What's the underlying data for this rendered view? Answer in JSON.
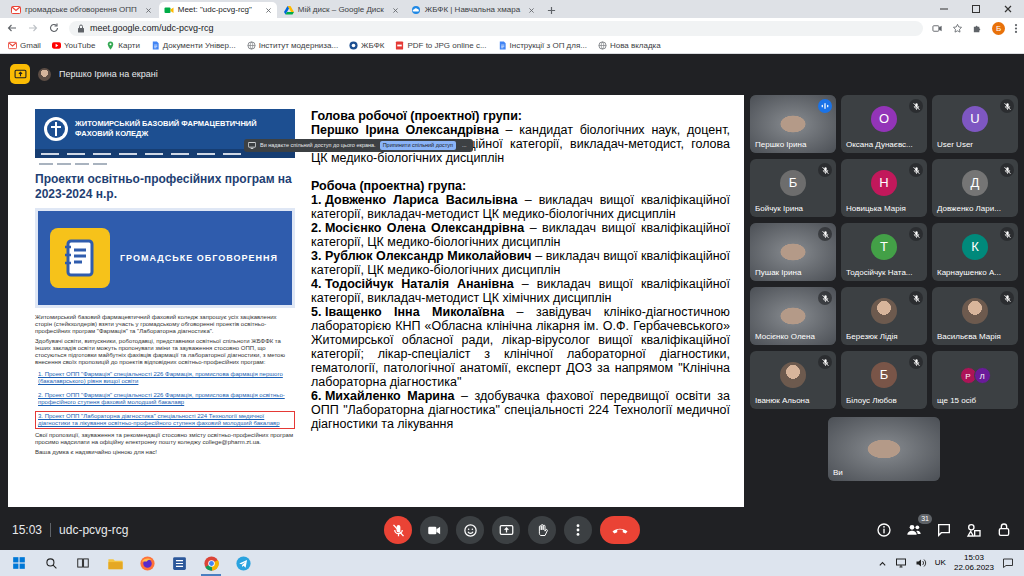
{
  "browser": {
    "tabs": [
      {
        "label": "громадське обговорення ОПП",
        "selected": false,
        "kind": "gmail"
      },
      {
        "label": "Meet: \"udc-pcvg-rcg\"",
        "selected": true,
        "kind": "meet"
      },
      {
        "label": "Мій диск – Google Диск",
        "selected": false,
        "kind": "drive"
      },
      {
        "label": "ЖБФК | Навчальна хмара",
        "selected": false,
        "kind": "cloud"
      }
    ],
    "address": "meet.google.com/udc-pcvg-rcg",
    "profile": "Б",
    "bookmarks": [
      {
        "label": "Gmail",
        "kind": "gmail"
      },
      {
        "label": "YouTube",
        "kind": "youtube"
      },
      {
        "label": "Карти",
        "kind": "maps"
      },
      {
        "label": "Документи Універ...",
        "kind": "docs"
      },
      {
        "label": "Інститут модерниза...",
        "kind": "globe"
      },
      {
        "label": "ЖБФК",
        "kind": "college"
      },
      {
        "label": "PDF to JPG online c...",
        "kind": "pdf"
      },
      {
        "label": "Інструкції з ОП для...",
        "kind": "docs"
      },
      {
        "label": "Нова вкладка",
        "kind": "globe"
      }
    ]
  },
  "meet": {
    "presenting": "Першко Ірина на екрані",
    "share_banner": {
      "text": "Ви надаєте спільний доступ до цього екрана.",
      "stop": "Припинити спільний доступ",
      "more": "..."
    },
    "slide": {
      "site": {
        "logo": [
          "ЖИТОМИРСЬКИЙ БАЗОВИЙ ФАРМАЦЕВТИЧНИЙ",
          "ФАХОВИЙ КОЛЕДЖ"
        ],
        "title": "Проекти освітньо-професійних програм на 2023-2024 н.р.",
        "banner": "ГРОМАДСЬКЕ ОБГОВОРЕННЯ",
        "intro": [
          "Житомирський базовий фармацевтичний фаховий коледж запрошує усіх зацікавлених сторін (стейкхолдерів) взяти участь у громадському обговоренні проектів освітньо-професійних програм \"Фармація\" та \"Лабораторна діагностика\".",
          "Здобувачі освіти, випускники, роботодавці, представники освітньої спільноти ЖБФФК та інших закладів освіти можуть пропонувати зміни та зауваження стосовно ОПП, що стосуються підготовки майбутніх фахівців фармації та лабораторної діагностики, з метою внесення своїх пропозицій до проектів відповідних освітньо-професійних програм:"
        ],
        "links": [
          {
            "text": "1. Проект ОПП \"Фармація\" спеціальності 226 Фармація, промислова фармація першого (бакалаврського) рівня вищої освіти",
            "selected": false
          },
          {
            "text": "2. Проект ОПП \"Фармація\" спеціальності 226 Фармація, промислова фармація освітньо-професійного ступеня фаховий молодший бакалавр",
            "selected": false
          },
          {
            "text": "3. Проект ОПП \"Лабораторна діагностика\" спеціальності 224 Технології медичної діагностики та лікування освітньо-професійного ступеня фаховий молодший бакалавр",
            "selected": true
          }
        ],
        "outro": [
          "Свої пропозиції, зауваження та рекомендації стосовно змісту освітньо-професійних програм просимо надсилати на офіційну електронну пошту коледжу college@pharm.zt.ua.",
          "Ваша думка є надзвичайно цінною для нас!"
        ]
      },
      "head_title": "Голова робочої (проектної) групи:",
      "head_name": "Першко Ірина Олександрівна",
      "head_desc": " – кандидат біологічних наук, доцент, викладач вищої кваліфікаційної категорії, викладач-методист, голова ЦК медико-біологічних дисциплін",
      "group_title": "Робоча (проектна) група:",
      "members": [
        {
          "num": "1.",
          "name": "Довженко Лариса Васильівна",
          "desc": " – викладач вищої кваліфікаційної категорії, викладач-методист ЦК медико-біологічних дисциплін"
        },
        {
          "num": "2.",
          "name": "Мосієнко Олена Олександрівна",
          "desc": " – викладач вищої кваліфікаційної категорії, ЦК медико-біологічних дисциплін"
        },
        {
          "num": "3.",
          "name": "Рублюк Олександр Миколайович",
          "desc": " – викладач вищої кваліфікаційної категорії, ЦК медико-біологічних дисциплін"
        },
        {
          "num": "4.",
          "name": "Тодосійчук Наталія Ананівна",
          "desc": " – викладач вищої кваліфікаційної категорії, викладач-методист ЦК хімічних дисциплін"
        },
        {
          "num": "5.",
          "name": "Іващенко Інна Миколаївна",
          "desc": " – завідувач клініко-діагностичною лабораторією КНП «Обласна клінічна лікарня ім. О.Ф. Гербачевського» Житомирської обласної ради, лікар-вірусолог вищої кваліфікаційної категорії; лікар-спеціаліст з клінічної лабораторної діагностики, гематології, патологічної анатомії, експерт ДОЗ за напрямом \"Клінічна лабораторна діагностика\""
        },
        {
          "num": "6.",
          "name": "Михайленко Марина",
          "desc": " – здобувачка фахової передвищої освіти за ОПП \"Лабораторна діагностика\" спеціальності 224 Технології медичної діагностики та лікування"
        }
      ]
    },
    "participants": [
      {
        "name": "Першко Ірина",
        "kind": "video",
        "muted": false
      },
      {
        "name": "Оксана Дунаєвс...",
        "kind": "letter",
        "letter": "О",
        "color": "#9334b8",
        "muted": true
      },
      {
        "name": "User User",
        "kind": "letter",
        "letter": "U",
        "color": "#7e57c2",
        "muted": true
      },
      {
        "name": "Бойчук Ірина",
        "kind": "letter",
        "letter": "Б",
        "color": "#6d6d6d",
        "muted": true
      },
      {
        "name": "Новицька Марія",
        "kind": "letter",
        "letter": "Н",
        "color": "#c2185b",
        "muted": true
      },
      {
        "name": "Довженко Лари...",
        "kind": "letter",
        "letter": "Д",
        "color": "#757575",
        "muted": true
      },
      {
        "name": "Пушак Ірина",
        "kind": "video",
        "muted": true
      },
      {
        "name": "Тодосійчук Ната...",
        "kind": "letter",
        "letter": "Т",
        "color": "#43a047",
        "muted": true
      },
      {
        "name": "Карнаушенко А...",
        "kind": "letter",
        "letter": "К",
        "color": "#00897b",
        "muted": true
      },
      {
        "name": "Мосієнко Олена",
        "kind": "video",
        "muted": true
      },
      {
        "name": "Березюк Лідія",
        "kind": "photo",
        "muted": true
      },
      {
        "name": "Васильєва Марія",
        "kind": "photo",
        "muted": true
      },
      {
        "name": "Іванюк Альона",
        "kind": "photo",
        "muted": true
      },
      {
        "name": "Білоус Любов",
        "kind": "letter",
        "letter": "Б",
        "color": "#795548",
        "muted": true
      },
      {
        "name": "ще 15 осіб",
        "kind": "more",
        "avatars": [
          {
            "letter": "Р",
            "color": "#ad1457"
          },
          {
            "letter": "Л",
            "color": "#6a1b9a"
          }
        ]
      }
    ],
    "self": {
      "name": "Ви",
      "kind": "video"
    },
    "time": "15:03",
    "code": "udc-pcvg-rcg",
    "people_count": "31",
    "mic_muted": true
  },
  "taskbar": {
    "apps": [
      {
        "kind": "explorer",
        "active": false
      },
      {
        "kind": "firefox",
        "active": false
      },
      {
        "kind": "word",
        "active": false
      },
      {
        "kind": "chrome",
        "active": true
      },
      {
        "kind": "telegram",
        "active": false
      }
    ],
    "lang": "UK",
    "time": "15:03",
    "date": "22.06.2023"
  }
}
